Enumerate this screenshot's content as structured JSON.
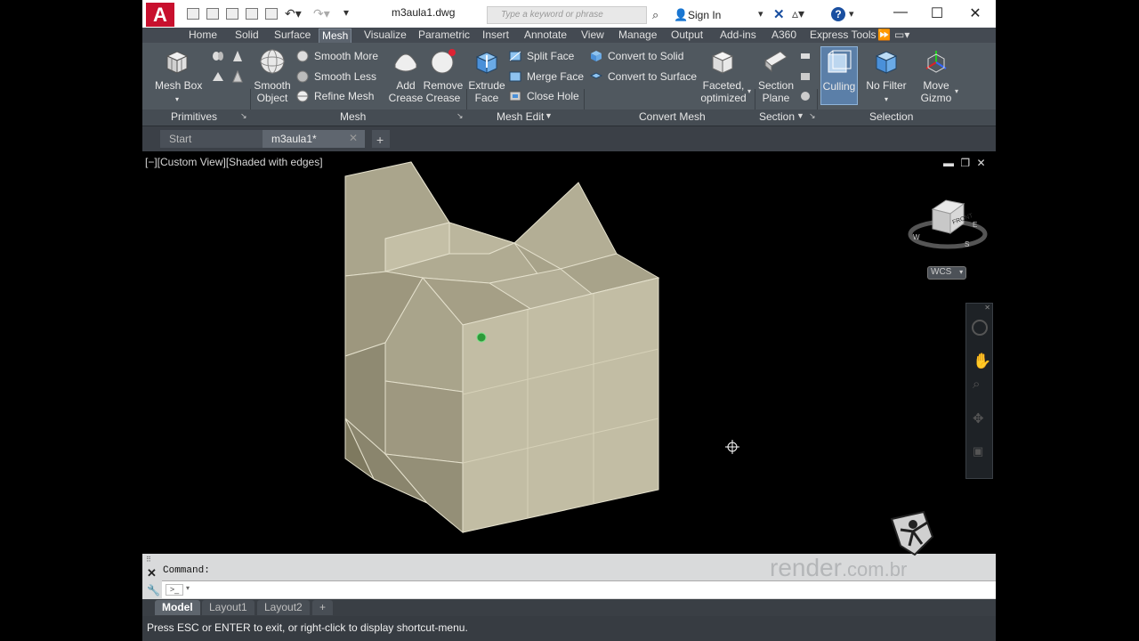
{
  "title_bar": {
    "logo": "A",
    "document_title": "m3aula1.dwg",
    "search_placeholder": "Type a keyword or phrase",
    "sign_in": "Sign In",
    "help_icon": "?"
  },
  "window_controls": {
    "minimize": "—",
    "maximize": "☐",
    "close": "✕"
  },
  "ribbon_tabs": [
    "Home",
    "Solid",
    "Surface",
    "Mesh",
    "Visualize",
    "Parametric",
    "Insert",
    "Annotate",
    "View",
    "Manage",
    "Output",
    "Add-ins",
    "A360",
    "Express Tools"
  ],
  "active_tab": "Mesh",
  "ribbon": {
    "primitives": {
      "title": "Primitives",
      "mesh_box": [
        "Mesh Box"
      ]
    },
    "mesh": {
      "title": "Mesh",
      "smooth_object": [
        "Smooth",
        "Object"
      ],
      "smooth_more": "Smooth More",
      "smooth_less": "Smooth Less",
      "refine_mesh": "Refine Mesh"
    },
    "mesh_edit": {
      "title": "Mesh Edit",
      "add_crease": [
        "Add",
        "Crease"
      ],
      "remove_crease": [
        "Remove",
        "Crease"
      ],
      "extrude_face": [
        "Extrude",
        "Face"
      ],
      "split_face": "Split Face",
      "merge_face": "Merge Face",
      "close_hole": "Close Hole"
    },
    "convert_mesh": {
      "title": "Convert Mesh",
      "convert_to_solid": "Convert to Solid",
      "convert_to_surface": "Convert to Surface",
      "faceted": [
        "Faceted,",
        "optimized"
      ]
    },
    "section": {
      "title": "Section",
      "section_plane": [
        "Section",
        "Plane"
      ]
    },
    "selection": {
      "title": "Selection",
      "culling": "Culling",
      "no_filter": "No Filter",
      "move_gizmo": [
        "Move",
        "Gizmo"
      ]
    }
  },
  "file_tabs": {
    "start": "Start",
    "document": "m3aula1*",
    "add": "+"
  },
  "viewport": {
    "label": "[−][Custom View][Shaded with edges]",
    "viewcube_face": "FRONT",
    "wcs": "WCS",
    "compass": {
      "w": "W",
      "s": "S",
      "e": "E"
    },
    "controls": {
      "minimize": "▬",
      "restore": "❐",
      "close": "✕"
    }
  },
  "command": {
    "history": "Command:",
    "prompt_icon": ">_"
  },
  "layout_tabs": [
    "Model",
    "Layout1",
    "Layout2"
  ],
  "layout_add": "+",
  "status_text": "Press ESC or ENTER to exit, or right-click to display shortcut-menu.",
  "watermark": {
    "main": "render",
    "domain": ".com.br"
  },
  "colors": {
    "mesh_face": "#b8b39a",
    "ribbon_bg": "#50585f",
    "tab_bar": "#444a52",
    "culling_active": "#5b7fa8",
    "logo_red": "#c8102e"
  }
}
